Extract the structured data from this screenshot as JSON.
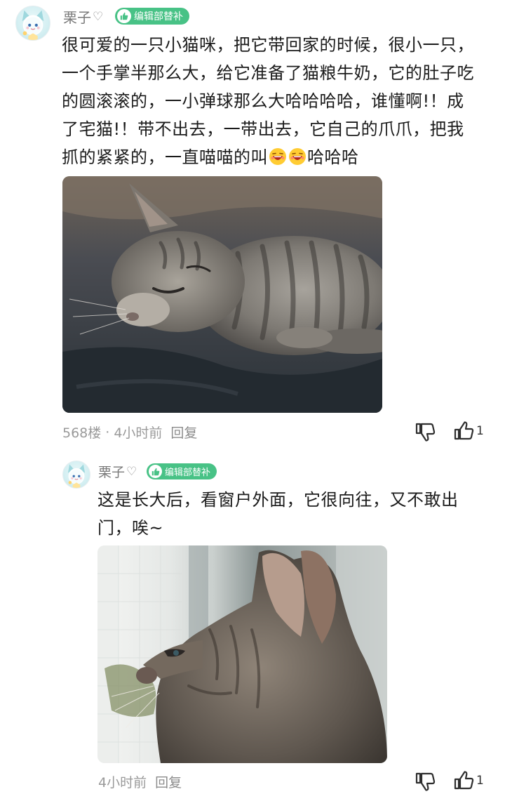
{
  "comment": {
    "user": "栗子",
    "heart": "♡",
    "badge": "编辑部替补",
    "text_before_emoji": "很可爱的一只小猫咪，把它带回家的时候，很小一只，一个手掌半那么大，给它准备了猫粮牛奶，它的肚子吃的圆滚滚的，一小弹球那么大哈哈哈哈，谁懂啊!！成了宅猫!！带不出去，一带出去，它自己的爪爪，把我抓的紧紧的，一直喵喵的叫",
    "text_after_emoji": "哈哈哈",
    "floor": "568楼",
    "dot": "·",
    "time": "4小时前",
    "reply": "回复",
    "like_count": "1",
    "photo_subject": "sleeping-kitten"
  },
  "reply": {
    "user": "栗子",
    "heart": "♡",
    "badge": "编辑部替补",
    "text": "这是长大后，看窗户外面，它很向往，又不敢出门，唉~",
    "time": "4小时前",
    "reply": "回复",
    "like_count": "1",
    "photo_subject": "kitten-at-window"
  },
  "colors": {
    "badge_green": "#48c286",
    "meta_gray": "#9a9a9a",
    "username_gray": "#7a7a7a"
  }
}
